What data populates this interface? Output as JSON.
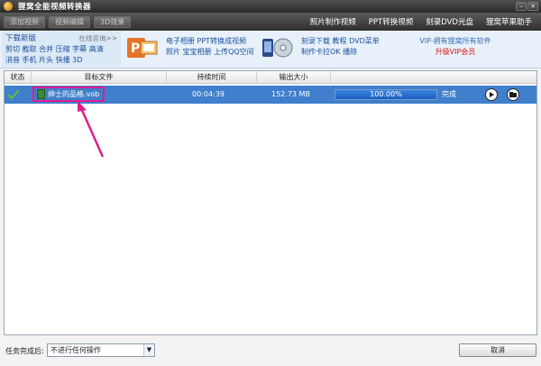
{
  "app": {
    "title": "狸窝全能视频转换器"
  },
  "window_controls": {
    "minimize": "–",
    "close": "×"
  },
  "toolbar": {
    "buttons": [
      "添加视频",
      "视频编辑",
      "3D效果"
    ],
    "links": [
      "照片制作视频",
      "PPT转换视频",
      "刻录DVD光盘",
      "狸窝苹果助手"
    ]
  },
  "banner": {
    "download_title": "下载新版",
    "more_link": "在线咨询>>",
    "features_line1": "剪切 截取 合并 压缩 字幕 高清",
    "features_line2": "消音 手机 片头 快播 3D",
    "promo1_line1": "电子相册 PPT转换成视频",
    "promo1_line2": "照片 宝宝相册 上传QQ空间",
    "promo2_line1": "刻录下载 教程 DVD菜单",
    "promo2_line2": "制作卡拉OK 播除",
    "vip_line1": "VIP-拥有狸窝所有软件",
    "vip_line2": "升级VIP会员"
  },
  "table": {
    "headers": [
      "状态",
      "目标文件",
      "持续时间",
      "输出大小"
    ],
    "rows": [
      {
        "file": "绅士的品格.vob",
        "duration": "00:04:39",
        "size": "152.73 MB",
        "progress_text": "100.00%",
        "progress": 1.0,
        "status": "完成"
      }
    ]
  },
  "bottom": {
    "after_label": "任务完成后:",
    "after_value": "不进行任何操作",
    "cancel_label": "取消"
  },
  "colors": {
    "row_selected": "#3f7fcb",
    "annotation": "#e01e8c",
    "vip_red": "#e01010"
  },
  "icons": [
    "app-logo-icon",
    "check-icon",
    "file-icon",
    "play-icon",
    "folder-icon",
    "dropdown-arrow-icon"
  ]
}
